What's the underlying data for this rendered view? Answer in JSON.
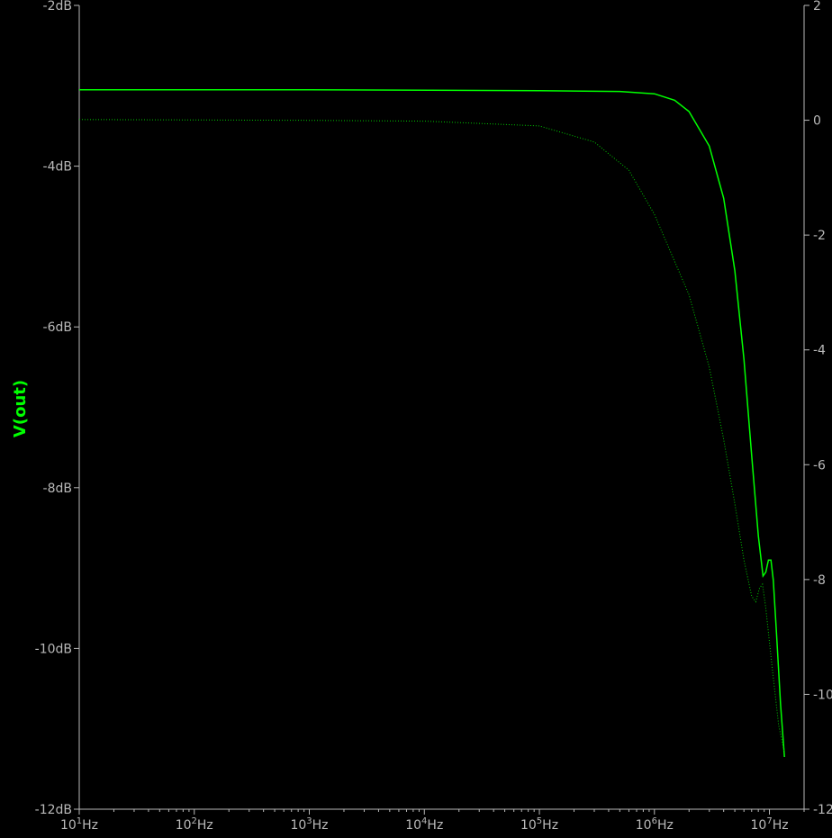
{
  "chart_data": {
    "type": "line",
    "ylabel": "V(out)",
    "x_scale": "log",
    "xlim": [
      10,
      20000000
    ],
    "ylim": [
      -12,
      -2
    ],
    "right_ylim": [
      -120,
      20
    ],
    "grid": false,
    "x_ticks": [
      {
        "value": 10,
        "base": "10",
        "exp": "1",
        "unit": "Hz"
      },
      {
        "value": 100,
        "base": "10",
        "exp": "2",
        "unit": "Hz"
      },
      {
        "value": 1000,
        "base": "10",
        "exp": "3",
        "unit": "Hz"
      },
      {
        "value": 10000,
        "base": "10",
        "exp": "4",
        "unit": "Hz"
      },
      {
        "value": 100000,
        "base": "10",
        "exp": "5",
        "unit": "Hz"
      },
      {
        "value": 1000000,
        "base": "10",
        "exp": "6",
        "unit": "Hz"
      },
      {
        "value": 10000000,
        "base": "10",
        "exp": "7",
        "unit": "Hz"
      }
    ],
    "y_ticks": [
      {
        "value": -2,
        "label": "-2dB"
      },
      {
        "value": -4,
        "label": "-4dB"
      },
      {
        "value": -6,
        "label": "-6dB"
      },
      {
        "value": -8,
        "label": "-8dB"
      },
      {
        "value": -10,
        "label": "-10dB"
      },
      {
        "value": -12,
        "label": "-12dB"
      }
    ],
    "right_ticks": [
      {
        "value": 20,
        "label": "2"
      },
      {
        "value": 0,
        "label": "0"
      },
      {
        "value": -20,
        "label": "-2"
      },
      {
        "value": -40,
        "label": "-4"
      },
      {
        "value": -60,
        "label": "-6"
      },
      {
        "value": -80,
        "label": "-8"
      },
      {
        "value": -100,
        "label": "-10"
      },
      {
        "value": -120,
        "label": "-12"
      }
    ],
    "series": [
      {
        "style": "solid",
        "color": "#00ff00",
        "points": [
          [
            10,
            -3.05
          ],
          [
            1000,
            -3.05
          ],
          [
            100000,
            -3.06
          ],
          [
            500000,
            -3.07
          ],
          [
            1000000,
            -3.1
          ],
          [
            1500000,
            -3.18
          ],
          [
            2000000,
            -3.32
          ],
          [
            3000000,
            -3.75
          ],
          [
            4000000,
            -4.4
          ],
          [
            5000000,
            -5.3
          ],
          [
            6000000,
            -6.4
          ],
          [
            7000000,
            -7.6
          ],
          [
            8000000,
            -8.6
          ],
          [
            8800000,
            -9.1
          ],
          [
            9300000,
            -9.05
          ],
          [
            9800000,
            -8.9
          ],
          [
            10300000,
            -8.9
          ],
          [
            10800000,
            -9.15
          ],
          [
            11500000,
            -9.8
          ],
          [
            12500000,
            -10.7
          ],
          [
            13500000,
            -11.35
          ]
        ]
      },
      {
        "style": "dotted",
        "color": "#00c800",
        "points": [
          [
            10,
            -3.42
          ],
          [
            1000,
            -3.43
          ],
          [
            10000,
            -3.44
          ],
          [
            100000,
            -3.5
          ],
          [
            300000,
            -3.7
          ],
          [
            600000,
            -4.05
          ],
          [
            1000000,
            -4.6
          ],
          [
            2000000,
            -5.6
          ],
          [
            3000000,
            -6.5
          ],
          [
            4000000,
            -7.4
          ],
          [
            5000000,
            -8.2
          ],
          [
            6000000,
            -8.9
          ],
          [
            7000000,
            -9.35
          ],
          [
            7600000,
            -9.42
          ],
          [
            8200000,
            -9.25
          ],
          [
            8700000,
            -9.2
          ],
          [
            9300000,
            -9.5
          ],
          [
            10500000,
            -10.2
          ],
          [
            12000000,
            -10.95
          ],
          [
            13500000,
            -11.3
          ]
        ]
      }
    ]
  },
  "colors": {
    "background": "#000000",
    "axis": "#b9b9b9",
    "label": "#00ff00"
  }
}
